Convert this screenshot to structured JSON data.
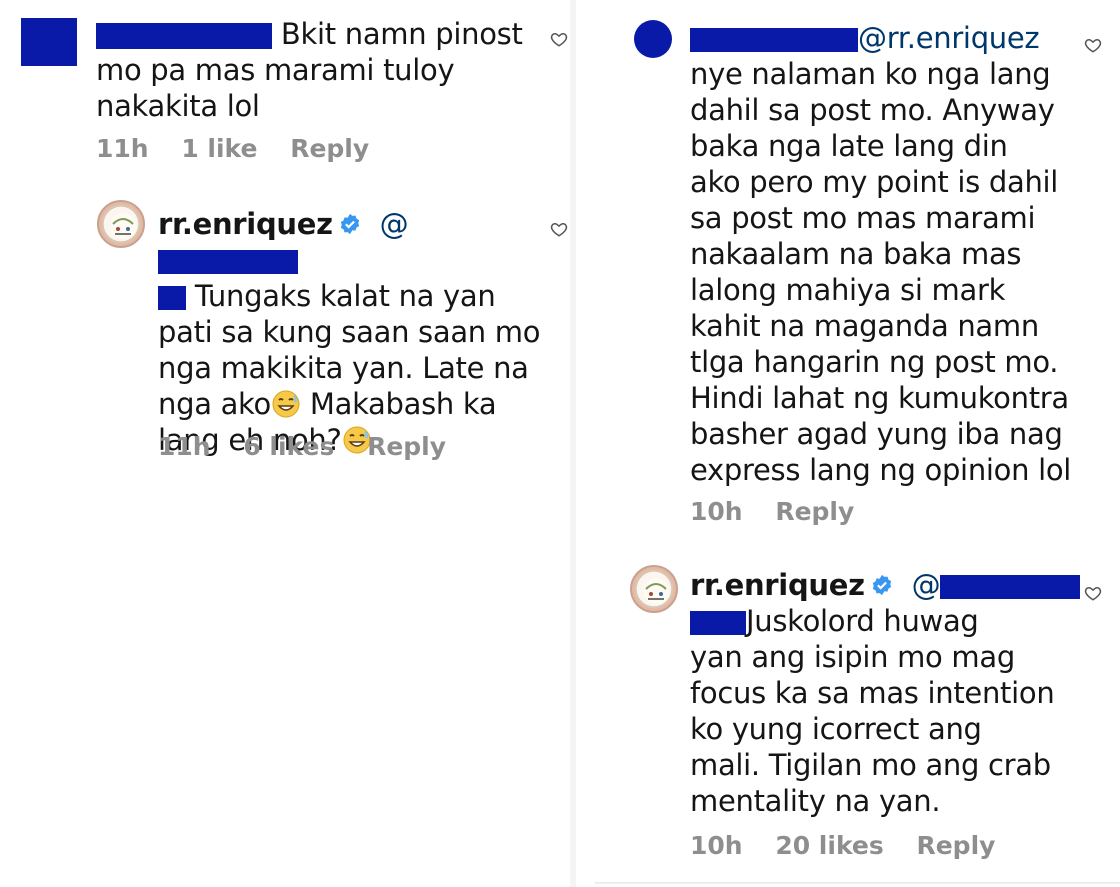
{
  "left": {
    "comment1": {
      "text_line1": "Bkit namn pinost",
      "text_line2": "mo pa mas marami tuloy",
      "text_line3": "nakakita lol",
      "time": "11h",
      "likes": "1 like",
      "reply": "Reply"
    },
    "reply1": {
      "username": "rr.enriquez",
      "line1": "Tungaks kalat na yan",
      "line2": "pati sa kung saan saan mo",
      "line3": "nga makikita yan. Late na",
      "line4a": "nga ako",
      "line4b": " Makabash ka",
      "line5": "lang eh noh?",
      "time": "11h",
      "likes": "6 likes",
      "reply": "Reply"
    }
  },
  "right": {
    "comment2": {
      "mention": "@rr.enriquez",
      "lines": [
        "nye nalaman ko nga lang",
        "dahil sa post mo. Anyway",
        "baka nga late lang din",
        "ako pero my point is dahil",
        "sa post mo mas marami",
        "nakaalam na baka mas",
        "lalong mahiya si mark",
        "kahit na maganda namn",
        "tlga hangarin ng post mo.",
        "Hindi lahat ng kumukontra",
        "basher agad yung iba nag",
        "express lang ng opinion lol"
      ],
      "time": "10h",
      "reply": "Reply"
    },
    "reply2": {
      "username": "rr.enriquez",
      "line1": "Juskolord huwag",
      "line2": "yan ang isipin mo mag",
      "line3": "focus ka sa mas intention",
      "line4": "ko yung icorrect ang",
      "line5": "mali. Tigilan mo ang crab",
      "line6": "mentality na yan.",
      "time": "10h",
      "likes": "20 likes",
      "reply": "Reply"
    }
  },
  "icons": {
    "heart": "heart-outline-icon",
    "verified": "verified-badge-icon",
    "emoji": "grinning-sweat-emoji"
  },
  "colors": {
    "redaction": "#0a1aa8",
    "meta_gray": "#8e8e8e",
    "verified_blue": "#3897f0",
    "mention_blue": "#00376b"
  }
}
